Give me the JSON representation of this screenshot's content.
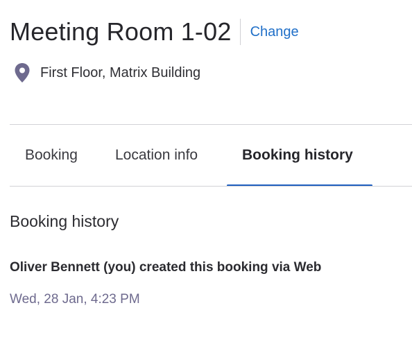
{
  "header": {
    "room_name": "Meeting Room 1-02",
    "change_label": "Change"
  },
  "location": {
    "icon": "location-pin-icon",
    "text": "First Floor, Matrix Building"
  },
  "tabs": [
    {
      "label": "Booking",
      "active": false
    },
    {
      "label": "Location info",
      "active": false
    },
    {
      "label": "Booking history",
      "active": true
    }
  ],
  "history": {
    "section_title": "Booking history",
    "entries": [
      {
        "text": "Oliver Bennett (you) created this booking via Web",
        "timestamp": "Wed, 28 Jan, 4:23 PM"
      }
    ]
  },
  "colors": {
    "link": "#1f6fc8",
    "tab_indicator": "#1f5fbf",
    "pin": "#6e6a8e",
    "timestamp": "#6e6a8e"
  }
}
